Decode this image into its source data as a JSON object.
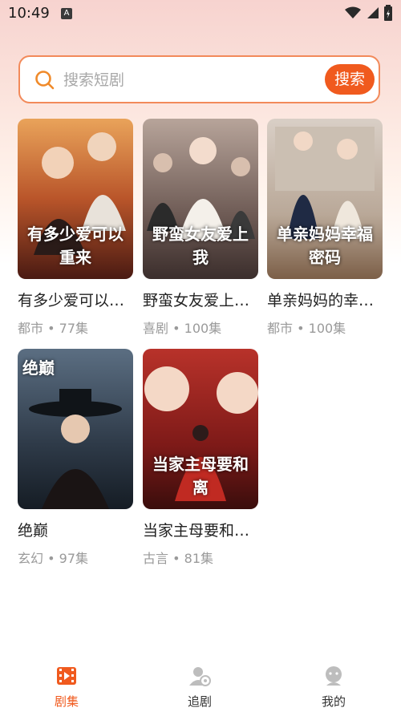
{
  "status_bar": {
    "time": "10:49",
    "notification_icon": "A"
  },
  "search": {
    "placeholder": "搜索短剧",
    "value": "",
    "button_label": "搜索"
  },
  "dramas": [
    {
      "title": "有多少爱可以…",
      "genre": "都市",
      "episodes": "77集",
      "poster_text": "有多少爱可以重来"
    },
    {
      "title": "野蛮女友爱上…",
      "genre": "喜剧",
      "episodes": "100集",
      "poster_text": "野蛮女友爱上我"
    },
    {
      "title": "单亲妈妈的幸…",
      "genre": "都市",
      "episodes": "100集",
      "poster_text": "单亲妈妈幸福密码"
    },
    {
      "title": "绝巅",
      "genre": "玄幻",
      "episodes": "97集",
      "poster_text": "绝巅"
    },
    {
      "title": "当家主母要和…",
      "genre": "古言",
      "episodes": "81集",
      "poster_text": "当家主母要和离"
    }
  ],
  "meta_separator": "•",
  "tabs": [
    {
      "label": "剧集",
      "icon": "film-icon",
      "active": true
    },
    {
      "label": "追剧",
      "icon": "follow-user-icon",
      "active": false
    },
    {
      "label": "我的",
      "icon": "profile-icon",
      "active": false
    }
  ],
  "colors": {
    "accent": "#f05a1e",
    "search_border": "#f28a5a"
  }
}
